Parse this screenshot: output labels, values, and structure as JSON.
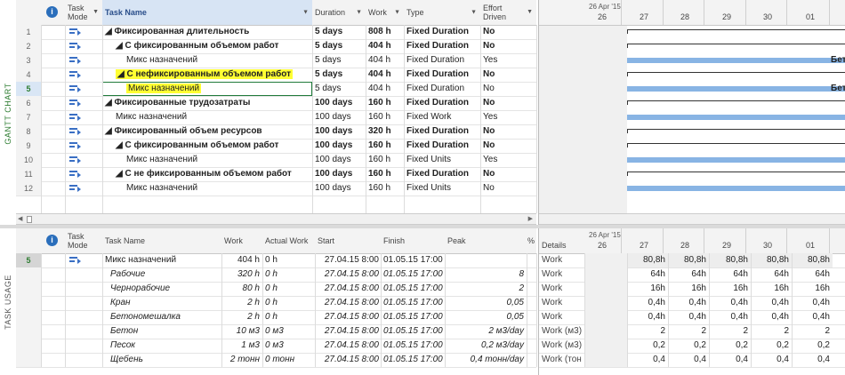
{
  "views": {
    "gantt_label": "GANTT CHART",
    "usage_label": "TASK USAGE"
  },
  "colors": {
    "accent": "#2e7d32",
    "bar": "#88b4e4",
    "highlight": "#ffff33",
    "nonworking": "#f0f0f0"
  },
  "gantt": {
    "headers": {
      "info": "i",
      "task_mode_1": "Task",
      "task_mode_2": "Mode",
      "task_name": "Task Name",
      "duration": "Duration",
      "work": "Work",
      "type": "Type",
      "effort_1": "Effort",
      "effort_2": "Driven"
    },
    "rows": [
      {
        "id": "1",
        "name": "◢ Фиксированная длительность",
        "indent": 0,
        "bold": true,
        "duration": "5 days",
        "work": "808 h",
        "type": "Fixed Duration",
        "effort": "No"
      },
      {
        "id": "2",
        "name": "◢ С фиксированным объемом работ",
        "indent": 1,
        "bold": true,
        "duration": "5 days",
        "work": "404 h",
        "type": "Fixed Duration",
        "effort": "No"
      },
      {
        "id": "3",
        "name": "Микс назначений",
        "indent": 2,
        "bold": false,
        "duration": "5 days",
        "work": "404 h",
        "type": "Fixed Duration",
        "effort": "Yes"
      },
      {
        "id": "4",
        "name": "◢ С нефиксированным объемом работ",
        "indent": 1,
        "bold": true,
        "hl": true,
        "duration": "5 days",
        "work": "404 h",
        "type": "Fixed Duration",
        "effort": "No"
      },
      {
        "id": "5",
        "name": "Микс назначений",
        "indent": 2,
        "bold": false,
        "hl": true,
        "selected": true,
        "duration": "5 days",
        "work": "404 h",
        "type": "Fixed Duration",
        "effort": "No"
      },
      {
        "id": "6",
        "name": "◢ Фиксированные трудозатраты",
        "indent": 0,
        "bold": true,
        "duration": "100 days",
        "work": "160 h",
        "type": "Fixed Duration",
        "effort": "No"
      },
      {
        "id": "7",
        "name": "Микс назначений",
        "indent": 1,
        "bold": false,
        "duration": "100 days",
        "work": "160 h",
        "type": "Fixed Work",
        "effort": "Yes"
      },
      {
        "id": "8",
        "name": "◢ Фиксированный объем ресурсов",
        "indent": 0,
        "bold": true,
        "duration": "100 days",
        "work": "320 h",
        "type": "Fixed Duration",
        "effort": "No"
      },
      {
        "id": "9",
        "name": "◢ С фиксированным объемом работ",
        "indent": 1,
        "bold": true,
        "duration": "100 days",
        "work": "160 h",
        "type": "Fixed Duration",
        "effort": "No"
      },
      {
        "id": "10",
        "name": "Микс назначений",
        "indent": 2,
        "bold": false,
        "duration": "100 days",
        "work": "160 h",
        "type": "Fixed Units",
        "effort": "Yes"
      },
      {
        "id": "11",
        "name": "◢ С не фиксированным объемом работ",
        "indent": 1,
        "bold": true,
        "duration": "100 days",
        "work": "160 h",
        "type": "Fixed Duration",
        "effort": "No"
      },
      {
        "id": "12",
        "name": "Микс назначений",
        "indent": 2,
        "bold": false,
        "duration": "100 days",
        "work": "160 h",
        "type": "Fixed Units",
        "effort": "No"
      }
    ],
    "timeline": {
      "week": "26 Apr '15",
      "days": [
        "26",
        "27",
        "28",
        "29",
        "30",
        "01"
      ]
    },
    "bar_labels": {
      "row3": "Бетон",
      "row5": "Бетон"
    }
  },
  "usage": {
    "headers": {
      "info": "i",
      "task_mode_1": "Task",
      "task_mode_2": "Mode",
      "task_name": "Task Name",
      "work": "Work",
      "actual_work": "Actual Work",
      "start": "Start",
      "finish": "Finish",
      "peak": "Peak",
      "pct": "%",
      "details": "Details"
    },
    "timeline": {
      "week": "26 Apr '15",
      "days": [
        "26",
        "27",
        "28",
        "29",
        "30",
        "01"
      ]
    },
    "rows": [
      {
        "id": "5",
        "name": "Микс назначений",
        "task": true,
        "work": "404 h",
        "actual": "0 h",
        "start": "27.04.15 8:00",
        "finish": "01.05.15 17:00",
        "peak": "",
        "detail": "Work",
        "vals": [
          "",
          "80,8h",
          "80,8h",
          "80,8h",
          "80,8h",
          "80,8h"
        ]
      },
      {
        "id": "",
        "name": "Рабочие",
        "work": "320 h",
        "actual": "0 h",
        "start": "27.04.15 8:00",
        "finish": "01.05.15 17:00",
        "peak": "8",
        "detail": "Work",
        "vals": [
          "",
          "64h",
          "64h",
          "64h",
          "64h",
          "64h"
        ]
      },
      {
        "id": "",
        "name": "Чернорабочие",
        "work": "80 h",
        "actual": "0 h",
        "start": "27.04.15 8:00",
        "finish": "01.05.15 17:00",
        "peak": "2",
        "detail": "Work",
        "vals": [
          "",
          "16h",
          "16h",
          "16h",
          "16h",
          "16h"
        ]
      },
      {
        "id": "",
        "name": "Кран",
        "work": "2 h",
        "actual": "0 h",
        "start": "27.04.15 8:00",
        "finish": "01.05.15 17:00",
        "peak": "0,05",
        "detail": "Work",
        "vals": [
          "",
          "0,4h",
          "0,4h",
          "0,4h",
          "0,4h",
          "0,4h"
        ]
      },
      {
        "id": "",
        "name": "Бетономешалка",
        "work": "2 h",
        "actual": "0 h",
        "start": "27.04.15 8:00",
        "finish": "01.05.15 17:00",
        "peak": "0,05",
        "detail": "Work",
        "vals": [
          "",
          "0,4h",
          "0,4h",
          "0,4h",
          "0,4h",
          "0,4h"
        ]
      },
      {
        "id": "",
        "name": "Бетон",
        "work": "10 м3",
        "actual": "0 м3",
        "start": "27.04.15 8:00",
        "finish": "01.05.15 17:00",
        "peak": "2 м3/day",
        "detail": "Work (м3)",
        "vals": [
          "",
          "2",
          "2",
          "2",
          "2",
          "2"
        ]
      },
      {
        "id": "",
        "name": "Песок",
        "work": "1 м3",
        "actual": "0 м3",
        "start": "27.04.15 8:00",
        "finish": "01.05.15 17:00",
        "peak": "0,2 м3/day",
        "detail": "Work (м3)",
        "vals": [
          "",
          "0,2",
          "0,2",
          "0,2",
          "0,2",
          "0,2"
        ]
      },
      {
        "id": "",
        "name": "Щебень",
        "work": "2 тонн",
        "actual": "0 тонн",
        "start": "27.04.15 8:00",
        "finish": "01.05.15 17:00",
        "peak": "0,4 тонн/day",
        "detail": "Work (тон",
        "vals": [
          "",
          "0,4",
          "0,4",
          "0,4",
          "0,4",
          "0,4"
        ]
      }
    ]
  }
}
